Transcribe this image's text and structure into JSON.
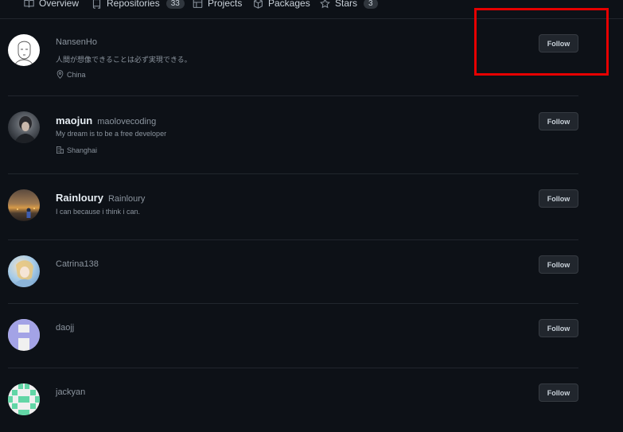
{
  "tabs": [
    {
      "label": "Overview",
      "icon": "book-icon"
    },
    {
      "label": "Repositories",
      "icon": "repo-icon",
      "count": "33"
    },
    {
      "label": "Projects",
      "icon": "table-icon"
    },
    {
      "label": "Packages",
      "icon": "package-icon"
    },
    {
      "label": "Stars",
      "icon": "star-icon",
      "count": "3"
    }
  ],
  "follow_label": "Follow",
  "users": [
    {
      "name": "",
      "login": "NansenHo",
      "bio": "人間が想像できることは必ず実現できる。",
      "meta": "China",
      "meta_icon": "location-icon"
    },
    {
      "name": "maojun",
      "login": "maolovecoding",
      "bio": "My dream is to be a free developer",
      "meta": "Shanghai",
      "meta_icon": "organization-icon"
    },
    {
      "name": "Rainloury",
      "login": "Rainloury",
      "bio": "I can because i think i can.",
      "meta": ""
    },
    {
      "name": "",
      "login": "Catrina138",
      "bio": "",
      "meta": ""
    },
    {
      "name": "",
      "login": "daojj",
      "bio": "",
      "meta": ""
    },
    {
      "name": "",
      "login": "jackyan",
      "bio": "",
      "meta": ""
    }
  ],
  "colors": {
    "background": "#0d1117",
    "highlight": "#e60000"
  }
}
